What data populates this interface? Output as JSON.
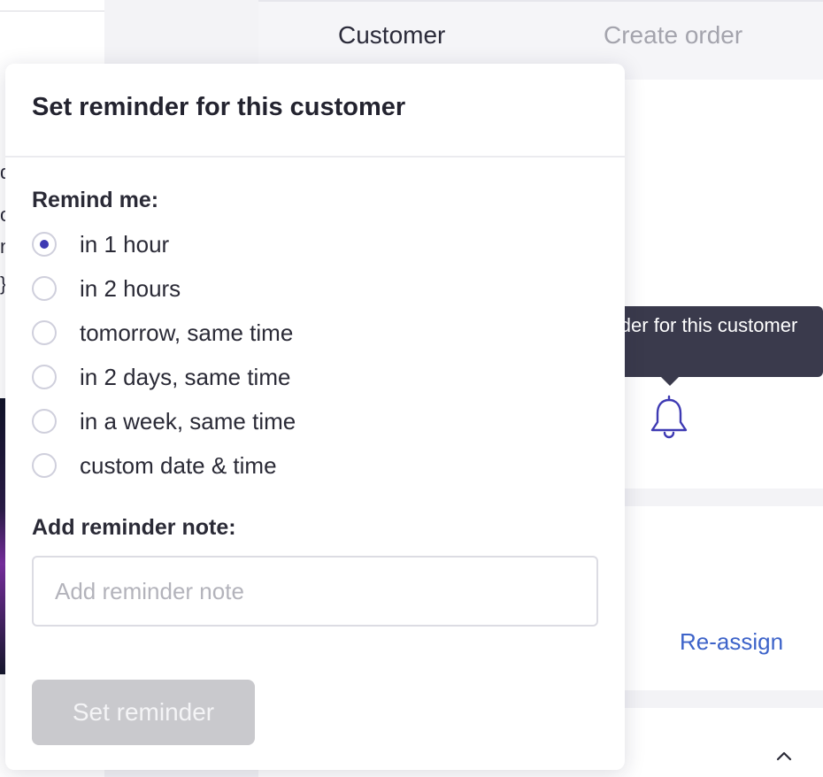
{
  "tabs": {
    "customer": "Customer",
    "create_order": "Create order"
  },
  "left_fragments": [
    "d",
    "o",
    "n",
    "}"
  ],
  "tooltip": {
    "text": "Set reminder for this customer"
  },
  "icons": {
    "bell": "bell-icon",
    "caret": "chevron-up-icon"
  },
  "reassign_label": "Re-assign",
  "popover": {
    "title": "Set reminder for this customer",
    "remind_label": "Remind me:",
    "options": [
      {
        "label": "in 1 hour",
        "selected": true
      },
      {
        "label": "in 2 hours",
        "selected": false
      },
      {
        "label": "tomorrow, same time",
        "selected": false
      },
      {
        "label": "in 2 days, same time",
        "selected": false
      },
      {
        "label": "in a week, same time",
        "selected": false
      },
      {
        "label": "custom date & time",
        "selected": false
      }
    ],
    "note_label": "Add reminder note:",
    "note_value": "",
    "note_placeholder": "Add reminder note",
    "submit_label": "Set reminder"
  },
  "colors": {
    "accent": "#3e3ab3",
    "link": "#3d63c9",
    "tooltip_bg": "#3a3a4c",
    "disabled_button": "#c9c9cd"
  }
}
